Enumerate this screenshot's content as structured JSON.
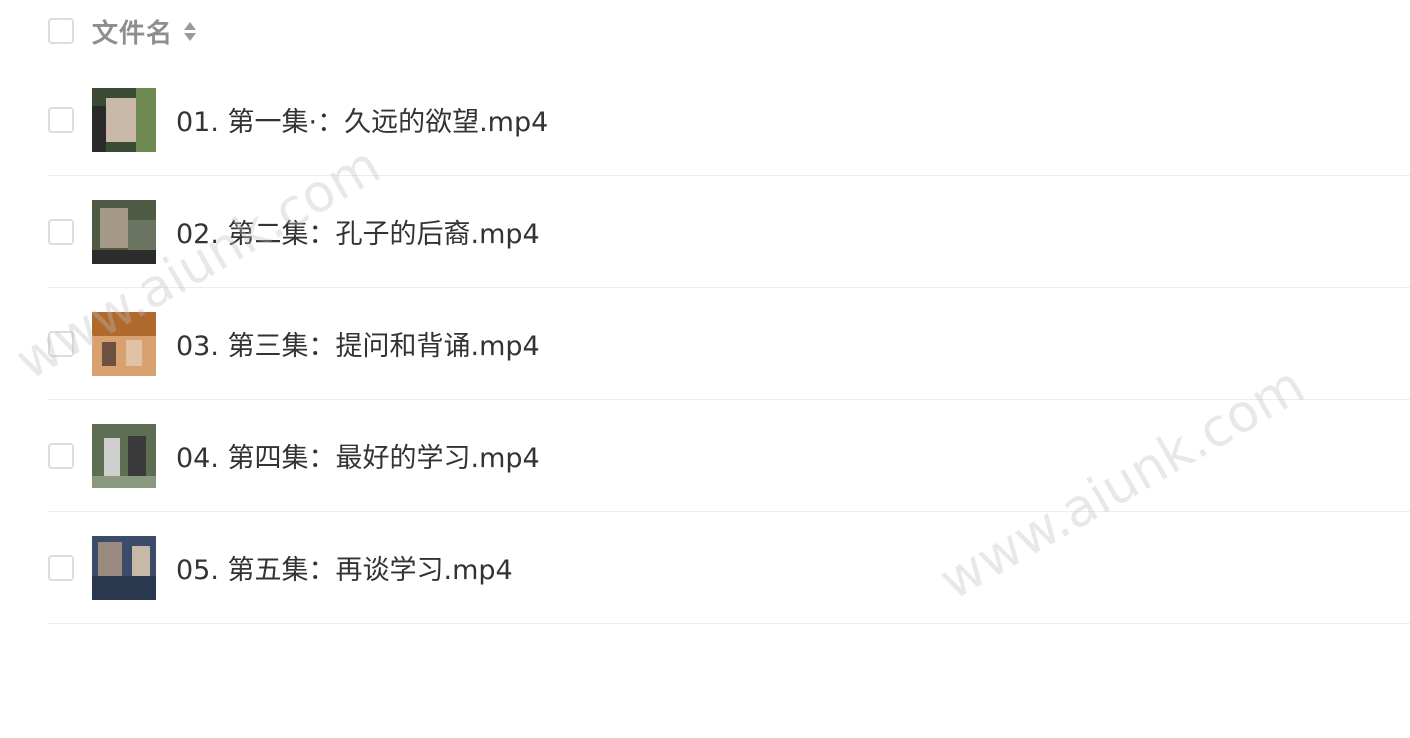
{
  "header": {
    "column_label": "文件名",
    "sort_icon": "sort-icon"
  },
  "files": [
    {
      "name": "01. 第一集·：久远的欲望.mp4",
      "thumb_colors": [
        "#3a4a35",
        "#c9b8a8",
        "#6e8a52",
        "#2a2a2a"
      ]
    },
    {
      "name": "02. 第二集：孔子的后裔.mp4",
      "thumb_colors": [
        "#4f5a44",
        "#a59a88",
        "#6a7460",
        "#2c2c2c"
      ]
    },
    {
      "name": "03. 第三集：提问和背诵.mp4",
      "thumb_colors": [
        "#b06a2e",
        "#d9a070",
        "#6e5040",
        "#e0c2a8"
      ]
    },
    {
      "name": "04. 第四集：最好的学习.mp4",
      "thumb_colors": [
        "#5d6e52",
        "#cfcfcf",
        "#3a3a3a",
        "#8a9a80"
      ]
    },
    {
      "name": "05. 第五集：再谈学习.mp4",
      "thumb_colors": [
        "#3b4b6a",
        "#9a8a80",
        "#2a3850",
        "#c8b8a8"
      ]
    }
  ],
  "watermark": {
    "text": "www.aiunk.com"
  }
}
